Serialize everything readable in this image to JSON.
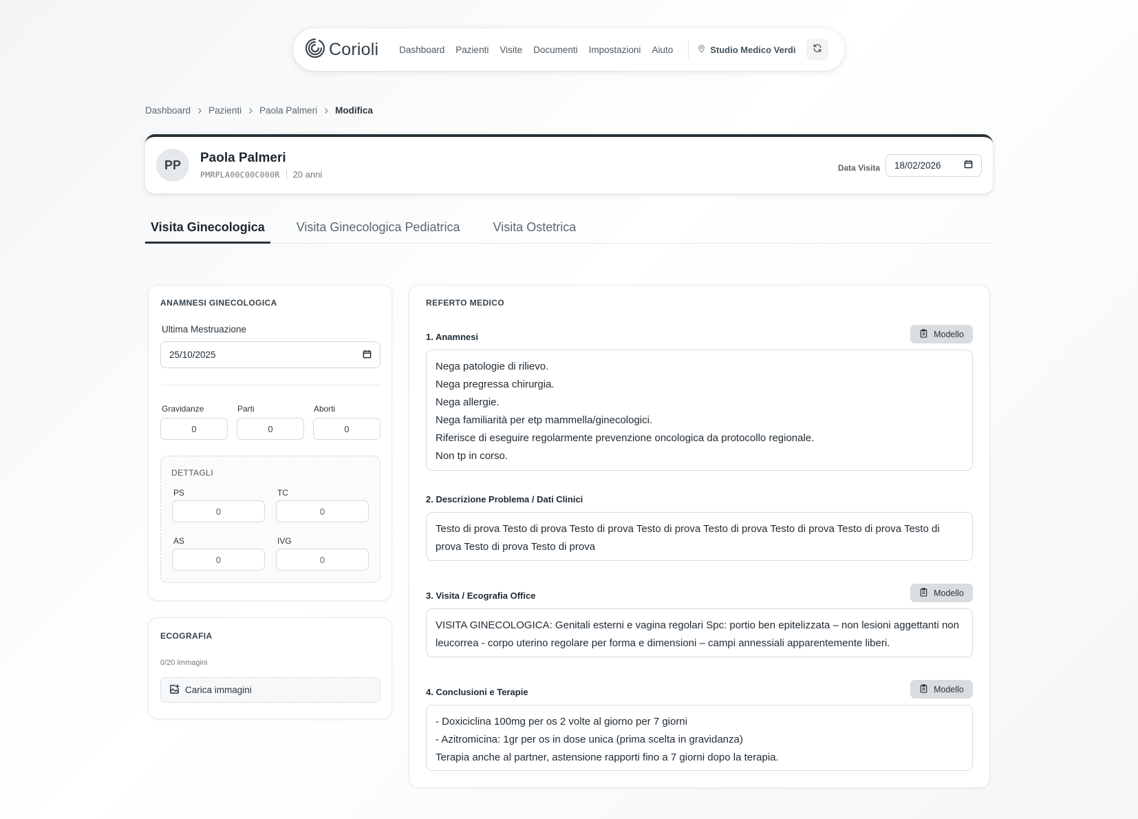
{
  "nav": {
    "brand": "Corioli",
    "links": [
      "Dashboard",
      "Pazienti",
      "Visite",
      "Documenti",
      "Impostazioni",
      "Aiuto"
    ],
    "studio": "Studio Medico Verdi"
  },
  "breadcrumb": {
    "items": [
      "Dashboard",
      "Pazienti",
      "Paola Palmeri"
    ],
    "current": "Modifica"
  },
  "patient": {
    "initials": "PP",
    "name": "Paola Palmeri",
    "fiscal_code": "PMRPLA00C00C000R",
    "age": "20 anni",
    "visit_date_label": "Data Visita",
    "visit_date": "18/02/2026"
  },
  "tabs": [
    "Visita Ginecologica",
    "Visita Ginecologica Pediatrica",
    "Visita Ostetrica"
  ],
  "anamnesi": {
    "title": "ANAMNESI GINECOLOGICA",
    "last_period_label": "Ultima Mestruazione",
    "last_period_value": "25/10/2025",
    "gravidanze_label": "Gravidanze",
    "gravidanze": "0",
    "parti_label": "Parti",
    "parti": "0",
    "aborti_label": "Aborti",
    "aborti": "0",
    "details_title": "DETTAGLI",
    "ps_label": "PS",
    "ps": "0",
    "tc_label": "TC",
    "tc": "0",
    "as_label": "AS",
    "as": "0",
    "ivg_label": "IVG",
    "ivg": "0"
  },
  "ecografia": {
    "title": "ECOGRAFIA",
    "count": "0/20 immagini",
    "upload_label": "Carica immagini"
  },
  "referto": {
    "title": "REFERTO MEDICO",
    "model_label": "Modello",
    "s1_title": "1. Anamnesi",
    "s1_text": "Nega patologie di rilievo.\nNega pregressa chirurgia.\nNega allergie.\nNega familiarità per etp mammella/ginecologici.\nRiferisce di eseguire regolarmente prevenzione oncologica da protocollo regionale.\nNon tp in corso.",
    "s2_title": "2. Descrizione Problema / Dati Clinici",
    "s2_text": "Testo di prova Testo di prova Testo di prova Testo di prova Testo di prova Testo di prova Testo di prova Testo di prova Testo di prova Testo di prova",
    "s3_title": "3. Visita / Ecografia Office",
    "s3_text": "VISITA GINECOLOGICA: Genitali esterni e vagina regolari Spc: portio ben epitelizzata – non lesioni aggettanti non leucorrea - corpo uterino regolare per forma e dimensioni – campi annessiali apparentemente liberi.",
    "s4_title": "4. Conclusioni e Terapie",
    "s4_text": "- Doxiciclina 100mg per os 2 volte al giorno per 7 giorni\n- Azitromicina: 1gr per os in dose unica (prima scelta in gravidanza)\nTerapia anche al partner, astensione rapporti fino a 7 giorni dopo la terapia."
  }
}
